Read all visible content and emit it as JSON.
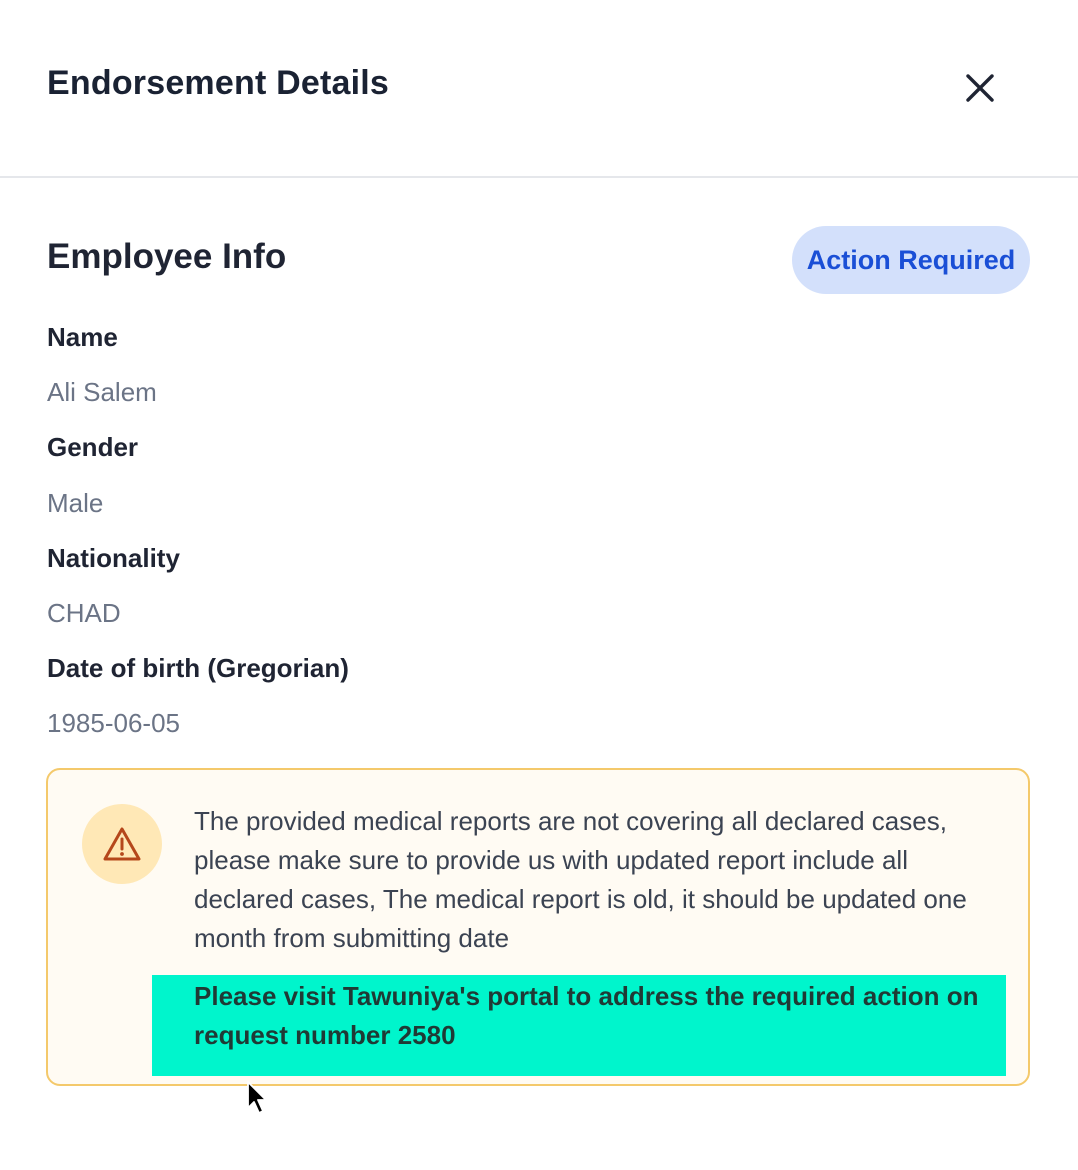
{
  "header": {
    "title": "Endorsement Details",
    "close_icon": "close-icon"
  },
  "employee_info": {
    "section_title": "Employee Info",
    "status_badge": "Action Required",
    "fields": [
      {
        "label": "Name",
        "value": "Ali Salem"
      },
      {
        "label": "Gender",
        "value": "Male"
      },
      {
        "label": "Nationality",
        "value": "CHAD"
      },
      {
        "label": "Date of birth (Gregorian)",
        "value": "1985-06-05"
      }
    ]
  },
  "alert": {
    "icon": "warning-icon",
    "message": "The provided medical reports are not covering all declared cases, please make sure to provide us with updated report include all declared cases, The medical report is old, it should be updated one month from submitting date",
    "action_text": "Please visit Tawuniya's portal to address the required action on request number 2580"
  },
  "colors": {
    "badge_bg": "#d3e0fb",
    "badge_text": "#1a4fd6",
    "alert_border": "#f4c96b",
    "alert_bg": "#fffbf3",
    "warning_icon": "#b5471b",
    "highlight": "#00f5cc"
  }
}
